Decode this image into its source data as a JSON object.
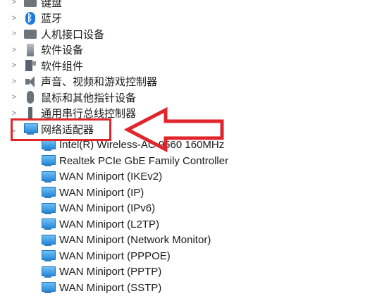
{
  "tree": {
    "categories": [
      {
        "label": "键盘",
        "icon": "keyboard-icon",
        "expanded": false
      },
      {
        "label": "蓝牙",
        "icon": "bluetooth-icon",
        "expanded": false
      },
      {
        "label": "人机接口设备",
        "icon": "hid-icon",
        "expanded": false
      },
      {
        "label": "软件设备",
        "icon": "software-device-icon",
        "expanded": false
      },
      {
        "label": "软件组件",
        "icon": "software-component-icon",
        "expanded": false
      },
      {
        "label": "声音、视频和游戏控制器",
        "icon": "audio-icon",
        "expanded": false
      },
      {
        "label": "鼠标和其他指针设备",
        "icon": "mouse-icon",
        "expanded": false
      },
      {
        "label": "通用串行总线控制器",
        "icon": "usb-icon",
        "expanded": false
      },
      {
        "label": "网络适配器",
        "icon": "network-adapter-icon",
        "expanded": true
      }
    ],
    "network_adapters": [
      "Intel(R) Wireless-AC 9560 160MHz",
      "Realtek PCIe GbE Family Controller",
      "WAN Miniport (IKEv2)",
      "WAN Miniport (IP)",
      "WAN Miniport (IPv6)",
      "WAN Miniport (L2TP)",
      "WAN Miniport (Network Monitor)",
      "WAN Miniport (PPPOE)",
      "WAN Miniport (PPTP)",
      "WAN Miniport (SSTP)"
    ]
  },
  "annotation": {
    "color": "#e0252b"
  }
}
